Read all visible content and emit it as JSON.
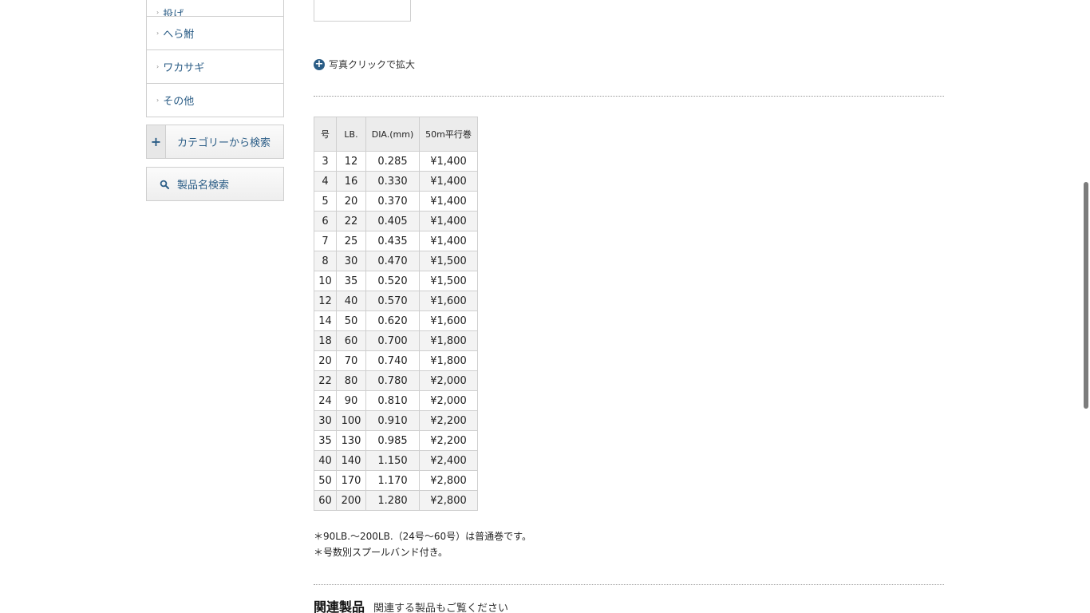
{
  "sidebar": {
    "categories": [
      {
        "label": "投げ"
      },
      {
        "label": "へら鮒"
      },
      {
        "label": "ワカサギ"
      },
      {
        "label": "その他"
      }
    ],
    "category_search": {
      "expand": "+",
      "label": "カテゴリーから検索"
    },
    "name_search": {
      "label": "製品名検索"
    }
  },
  "main": {
    "zoom_note": "写真クリックで拡大",
    "table": {
      "headers": [
        "号",
        "LB.",
        "DIA.(mm)",
        "50m平行巻"
      ],
      "rows": [
        [
          "3",
          "12",
          "0.285",
          "¥1,400"
        ],
        [
          "4",
          "16",
          "0.330",
          "¥1,400"
        ],
        [
          "5",
          "20",
          "0.370",
          "¥1,400"
        ],
        [
          "6",
          "22",
          "0.405",
          "¥1,400"
        ],
        [
          "7",
          "25",
          "0.435",
          "¥1,400"
        ],
        [
          "8",
          "30",
          "0.470",
          "¥1,500"
        ],
        [
          "10",
          "35",
          "0.520",
          "¥1,500"
        ],
        [
          "12",
          "40",
          "0.570",
          "¥1,600"
        ],
        [
          "14",
          "50",
          "0.620",
          "¥1,600"
        ],
        [
          "18",
          "60",
          "0.700",
          "¥1,800"
        ],
        [
          "20",
          "70",
          "0.740",
          "¥1,800"
        ],
        [
          "22",
          "80",
          "0.780",
          "¥2,000"
        ],
        [
          "24",
          "90",
          "0.810",
          "¥2,000"
        ],
        [
          "30",
          "100",
          "0.910",
          "¥2,200"
        ],
        [
          "35",
          "130",
          "0.985",
          "¥2,200"
        ],
        [
          "40",
          "140",
          "1.150",
          "¥2,400"
        ],
        [
          "50",
          "170",
          "1.170",
          "¥2,800"
        ],
        [
          "60",
          "200",
          "1.280",
          "¥2,800"
        ]
      ]
    },
    "notes": [
      "＊90LB.～200LB.（24号～60号）は普通巻です。",
      "＊号数別スプールバンド付き。"
    ],
    "related": {
      "title": "関連製品",
      "subtitle": "関連する製品もご覧ください"
    }
  },
  "colors": {
    "link": "#2b5d86",
    "border": "#cfcfcf",
    "header_bg": "#ececec"
  },
  "icons": {
    "category_arrow": "chevron-right-icon",
    "zoom": "plus-circle-icon",
    "search": "search-icon"
  }
}
